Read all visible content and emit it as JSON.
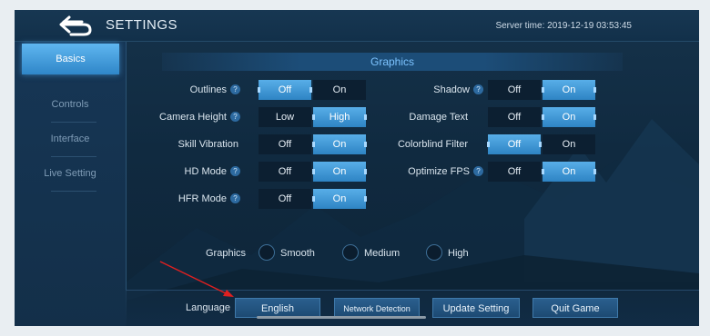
{
  "header": {
    "title": "SETTINGS",
    "server_time": "Server time: 2019-12-19 03:53:45"
  },
  "sidebar": {
    "items": [
      {
        "label": "Basics",
        "active": true
      },
      {
        "label": "Controls",
        "active": false
      },
      {
        "label": "Interface",
        "active": false
      },
      {
        "label": "Live Setting",
        "active": false
      }
    ]
  },
  "graphics": {
    "title": "Graphics",
    "help_glyph": "?",
    "left_settings": [
      {
        "label": "Outlines",
        "help": true,
        "options": [
          "Off",
          "On"
        ],
        "selected": "Off"
      },
      {
        "label": "Camera Height",
        "help": true,
        "options": [
          "Low",
          "High"
        ],
        "selected": "High"
      },
      {
        "label": "Skill Vibration",
        "help": false,
        "options": [
          "Off",
          "On"
        ],
        "selected": "On"
      },
      {
        "label": "HD Mode",
        "help": true,
        "options": [
          "Off",
          "On"
        ],
        "selected": "On"
      },
      {
        "label": "HFR Mode",
        "help": true,
        "options": [
          "Off",
          "On"
        ],
        "selected": "On"
      }
    ],
    "right_settings": [
      {
        "label": "Shadow",
        "help": true,
        "options": [
          "Off",
          "On"
        ],
        "selected": "On"
      },
      {
        "label": "Damage Text",
        "help": false,
        "options": [
          "Off",
          "On"
        ],
        "selected": "On"
      },
      {
        "label": "Colorblind Filter",
        "help": false,
        "options": [
          "Off",
          "On"
        ],
        "selected": "Off"
      },
      {
        "label": "Optimize FPS",
        "help": true,
        "options": [
          "Off",
          "On"
        ],
        "selected": "On"
      }
    ],
    "quality": {
      "label": "Graphics",
      "options": [
        "Smooth",
        "Medium",
        "High"
      ]
    }
  },
  "bottom": {
    "language_label": "Language",
    "language_value": "English",
    "network_detection": "Network Detection",
    "update_setting": "Update Setting",
    "quit_game": "Quit Game"
  },
  "colors": {
    "accent": "#3a94d8",
    "annotation_arrow": "#e02020"
  }
}
